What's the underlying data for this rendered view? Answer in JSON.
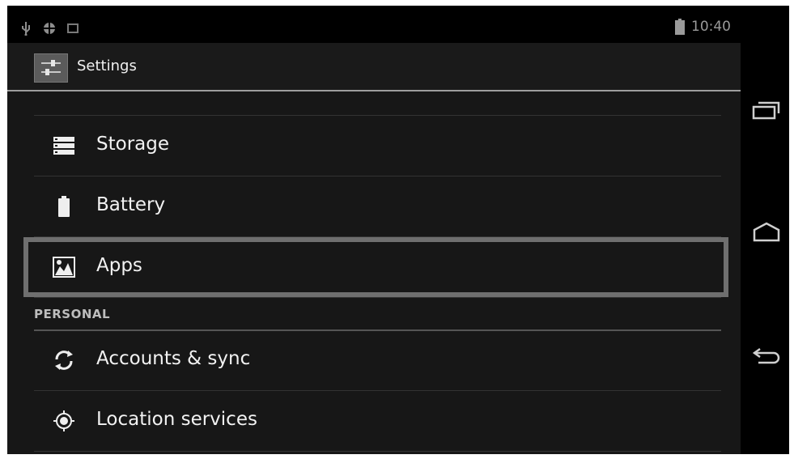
{
  "status": {
    "time": "10:40"
  },
  "header": {
    "title": "Settings"
  },
  "list": [
    {
      "label": "Storage"
    },
    {
      "label": "Battery"
    },
    {
      "label": "Apps"
    },
    {
      "label": "Accounts & sync"
    },
    {
      "label": "Location services"
    }
  ],
  "sections": {
    "personal": "PERSONAL"
  },
  "icons": {
    "status_left": [
      "usb-icon",
      "android-debug-icon",
      "screenshot-icon"
    ],
    "status_right": [
      "battery-icon"
    ],
    "items": [
      "storage-icon",
      "battery-icon",
      "apps-icon",
      "sync-icon",
      "location-icon"
    ],
    "nav": [
      "recent-apps-icon",
      "home-icon",
      "back-icon"
    ]
  },
  "colors": {
    "background": "#171717",
    "highlight_border": "#6f6f6f"
  }
}
